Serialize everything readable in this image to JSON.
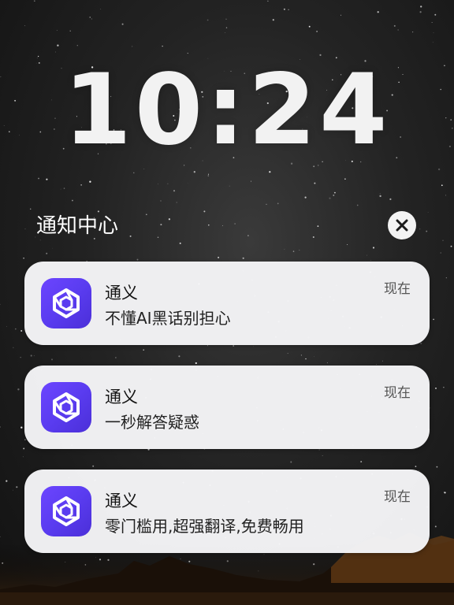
{
  "lockscreen": {
    "time": "10:24"
  },
  "notification_center": {
    "title": "通知中心",
    "close_icon": "close-icon",
    "notifications": [
      {
        "app_name": "通义",
        "message": "不懂AI黑话别担心",
        "time": "现在",
        "icon": "tongyi-app-icon"
      },
      {
        "app_name": "通义",
        "message": "一秒解答疑惑",
        "time": "现在",
        "icon": "tongyi-app-icon"
      },
      {
        "app_name": "通义",
        "message": "零门槛用,超强翻译,免费畅用",
        "time": "现在",
        "icon": "tongyi-app-icon"
      }
    ]
  },
  "colors": {
    "app_icon_gradient_start": "#6c45ff",
    "app_icon_gradient_end": "#4b2fd8",
    "card_background": "#f5f5f7",
    "clock_text": "#f2f2f2"
  }
}
